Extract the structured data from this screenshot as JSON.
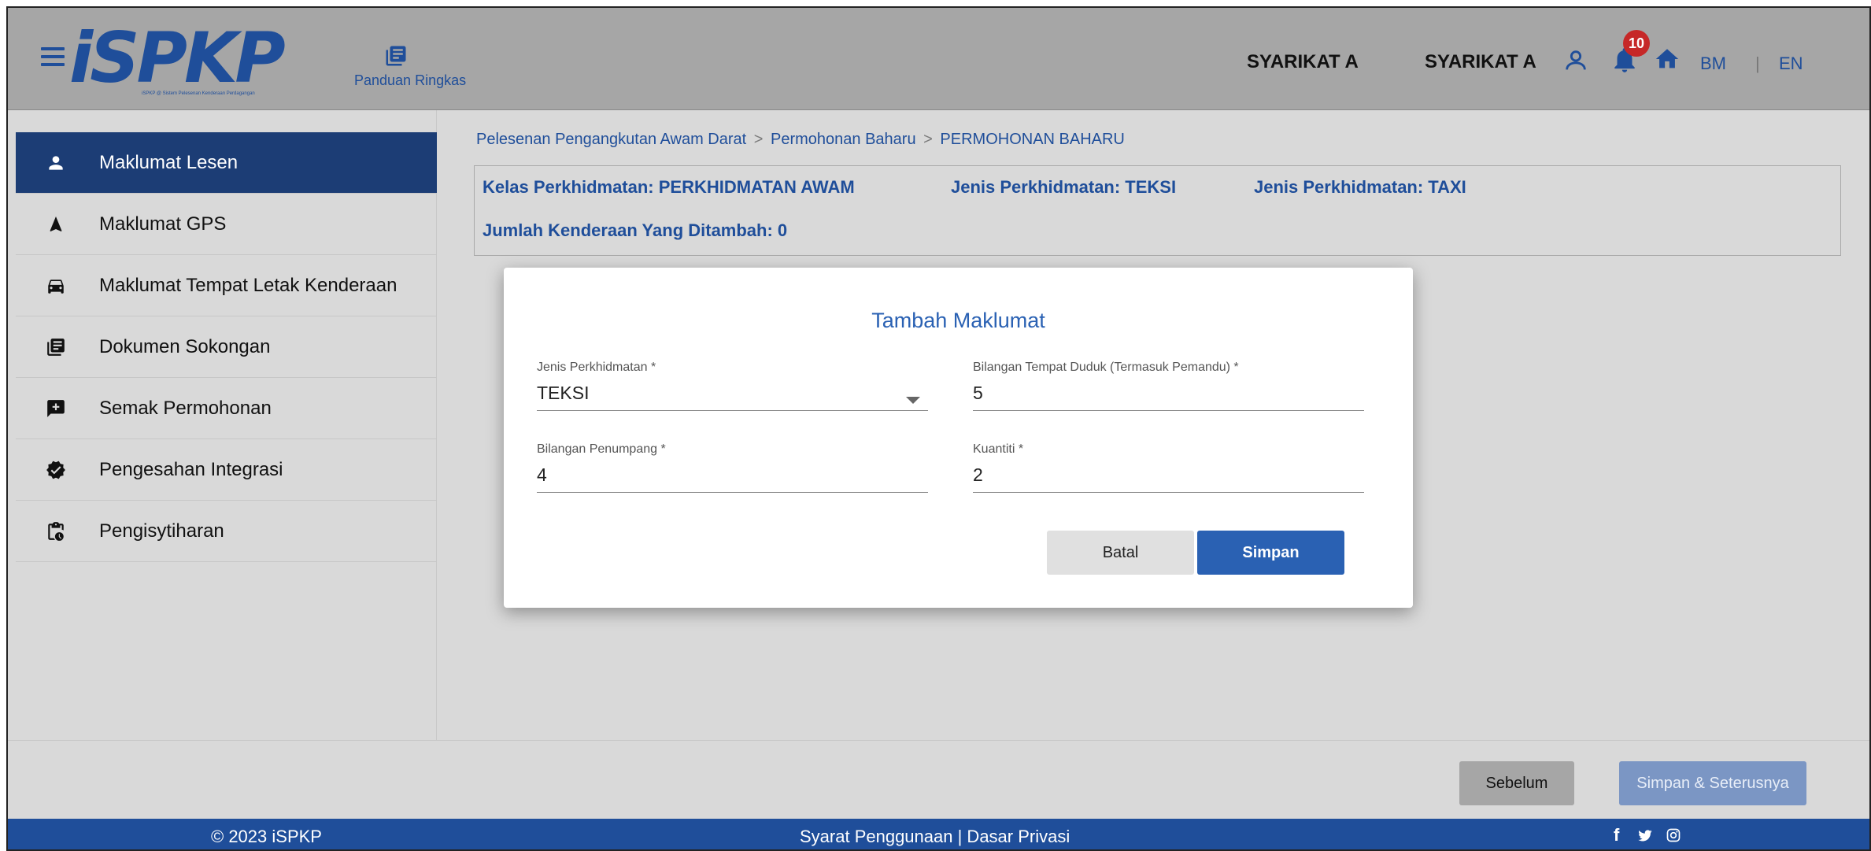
{
  "header": {
    "logo_text": "iSPKP",
    "logo_subtitle": "iSPKP @ Sistem Pelesenan Kenderaan Perdagangan",
    "guide_label": "Panduan Ringkas",
    "company_1": "SYARIKAT A",
    "company_2": "SYARIKAT A",
    "notification_count": "10",
    "lang_bm": "BM",
    "lang_separator": "|",
    "lang_en": "EN"
  },
  "sidebar": {
    "items": [
      {
        "label": "Maklumat Lesen",
        "icon": "person-icon",
        "active": true
      },
      {
        "label": "Maklumat GPS",
        "icon": "navigation-arrow-icon"
      },
      {
        "label": "Maklumat Tempat Letak Kenderaan",
        "icon": "car-icon"
      },
      {
        "label": "Dokumen Sokongan",
        "icon": "document-stack-icon"
      },
      {
        "label": "Semak Permohonan",
        "icon": "review-icon"
      },
      {
        "label": "Pengesahan Integrasi",
        "icon": "verified-badge-icon"
      },
      {
        "label": "Pengisytiharan",
        "icon": "clipboard-clock-icon"
      }
    ]
  },
  "breadcrumb": {
    "items": [
      "Pelesenan Pengangkutan Awam Darat",
      "Permohonan Baharu",
      "PERMOHONAN BAHARU"
    ],
    "separator": ">"
  },
  "info": {
    "kelas": "Kelas Perkhidmatan: PERKHIDMATAN AWAM",
    "jenis_1": "Jenis Perkhidmatan: TEKSI",
    "jenis_2": "Jenis Perkhidmatan: TAXI",
    "jumlah": "Jumlah Kenderaan Yang Ditambah: 0"
  },
  "modal": {
    "title": "Tambah Maklumat",
    "fields": {
      "jenis": {
        "label": "Jenis Perkhidmatan *",
        "value": "TEKSI"
      },
      "tempat_duduk": {
        "label": "Bilangan Tempat Duduk (Termasuk Pemandu) *",
        "value": "5"
      },
      "penumpang": {
        "label": "Bilangan Penumpang *",
        "value": "4"
      },
      "kuantiti": {
        "label": "Kuantiti *",
        "value": "2"
      }
    },
    "cancel_label": "Batal",
    "save_label": "Simpan"
  },
  "actions": {
    "prev_label": "Sebelum",
    "next_label": "Simpan & Seterusnya"
  },
  "footer": {
    "copyright": "© 2023 iSPKP",
    "links": "Syarat Penggunaan | Dasar Privasi",
    "social": "f 🐦 ◎"
  },
  "colors": {
    "primary": "#1f4e9a",
    "modal_accent": "#2a61b3",
    "sidebar_active": "#1c3d75",
    "badge": "#c62828"
  }
}
